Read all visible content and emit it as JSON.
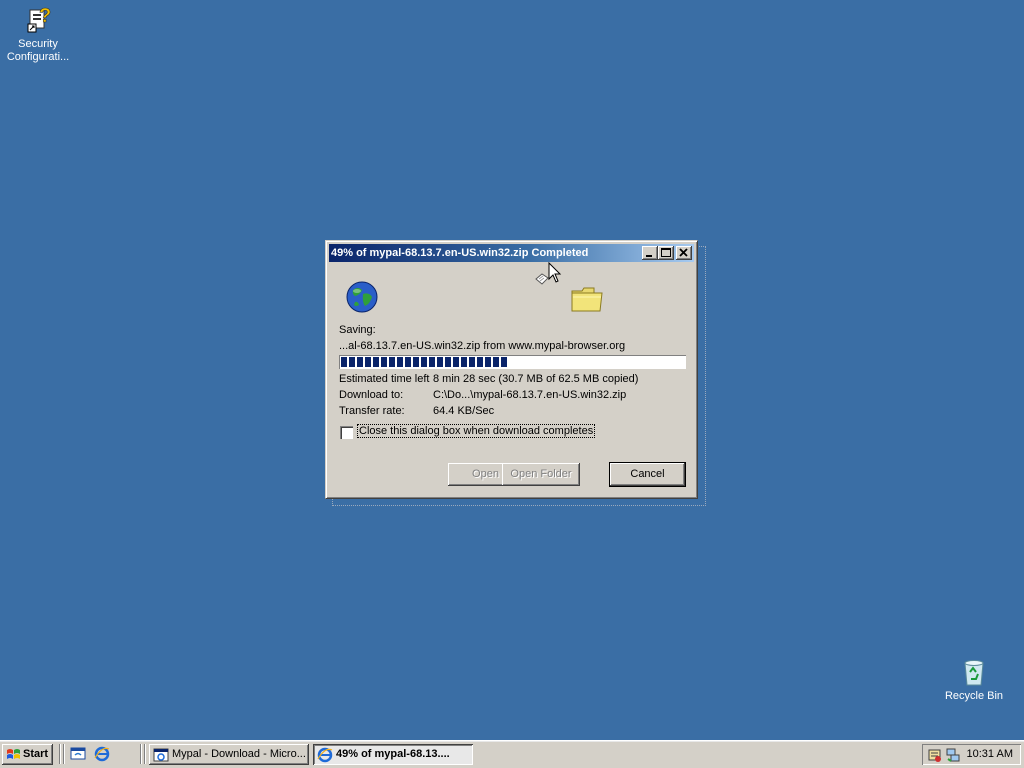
{
  "desktop": {
    "icons": [
      {
        "label": "Security Configurati...",
        "icon": "security-config-icon"
      },
      {
        "label": "Recycle Bin",
        "icon": "recycle-bin-icon"
      }
    ]
  },
  "dialog": {
    "title": "49% of mypal-68.13.7.en-US.win32.zip Completed",
    "saving_label": "Saving:",
    "saving_source": "...al-68.13.7.en-US.win32.zip from www.mypal-browser.org",
    "progress_percent": 49,
    "rows": [
      {
        "label": "Estimated time left",
        "value": "8 min 28 sec (30.7 MB of 62.5 MB copied)"
      },
      {
        "label": "Download to:",
        "value": "C:\\Do...\\mypal-68.13.7.en-US.win32.zip"
      },
      {
        "label": "Transfer rate:",
        "value": "64.4 KB/Sec"
      }
    ],
    "close_checkbox_label": "Close this dialog box when download completes",
    "close_checkbox_checked": false,
    "buttons": {
      "open": "Open",
      "open_folder": "Open Folder",
      "cancel": "Cancel"
    }
  },
  "taskbar": {
    "start_label": "Start",
    "tasks": [
      {
        "label": "Mypal - Download - Micro...",
        "icon": "ie-window-icon"
      },
      {
        "label": "49% of mypal-68.13....",
        "icon": "ie-download-icon",
        "active": true
      }
    ],
    "clock": "10:31 AM"
  }
}
